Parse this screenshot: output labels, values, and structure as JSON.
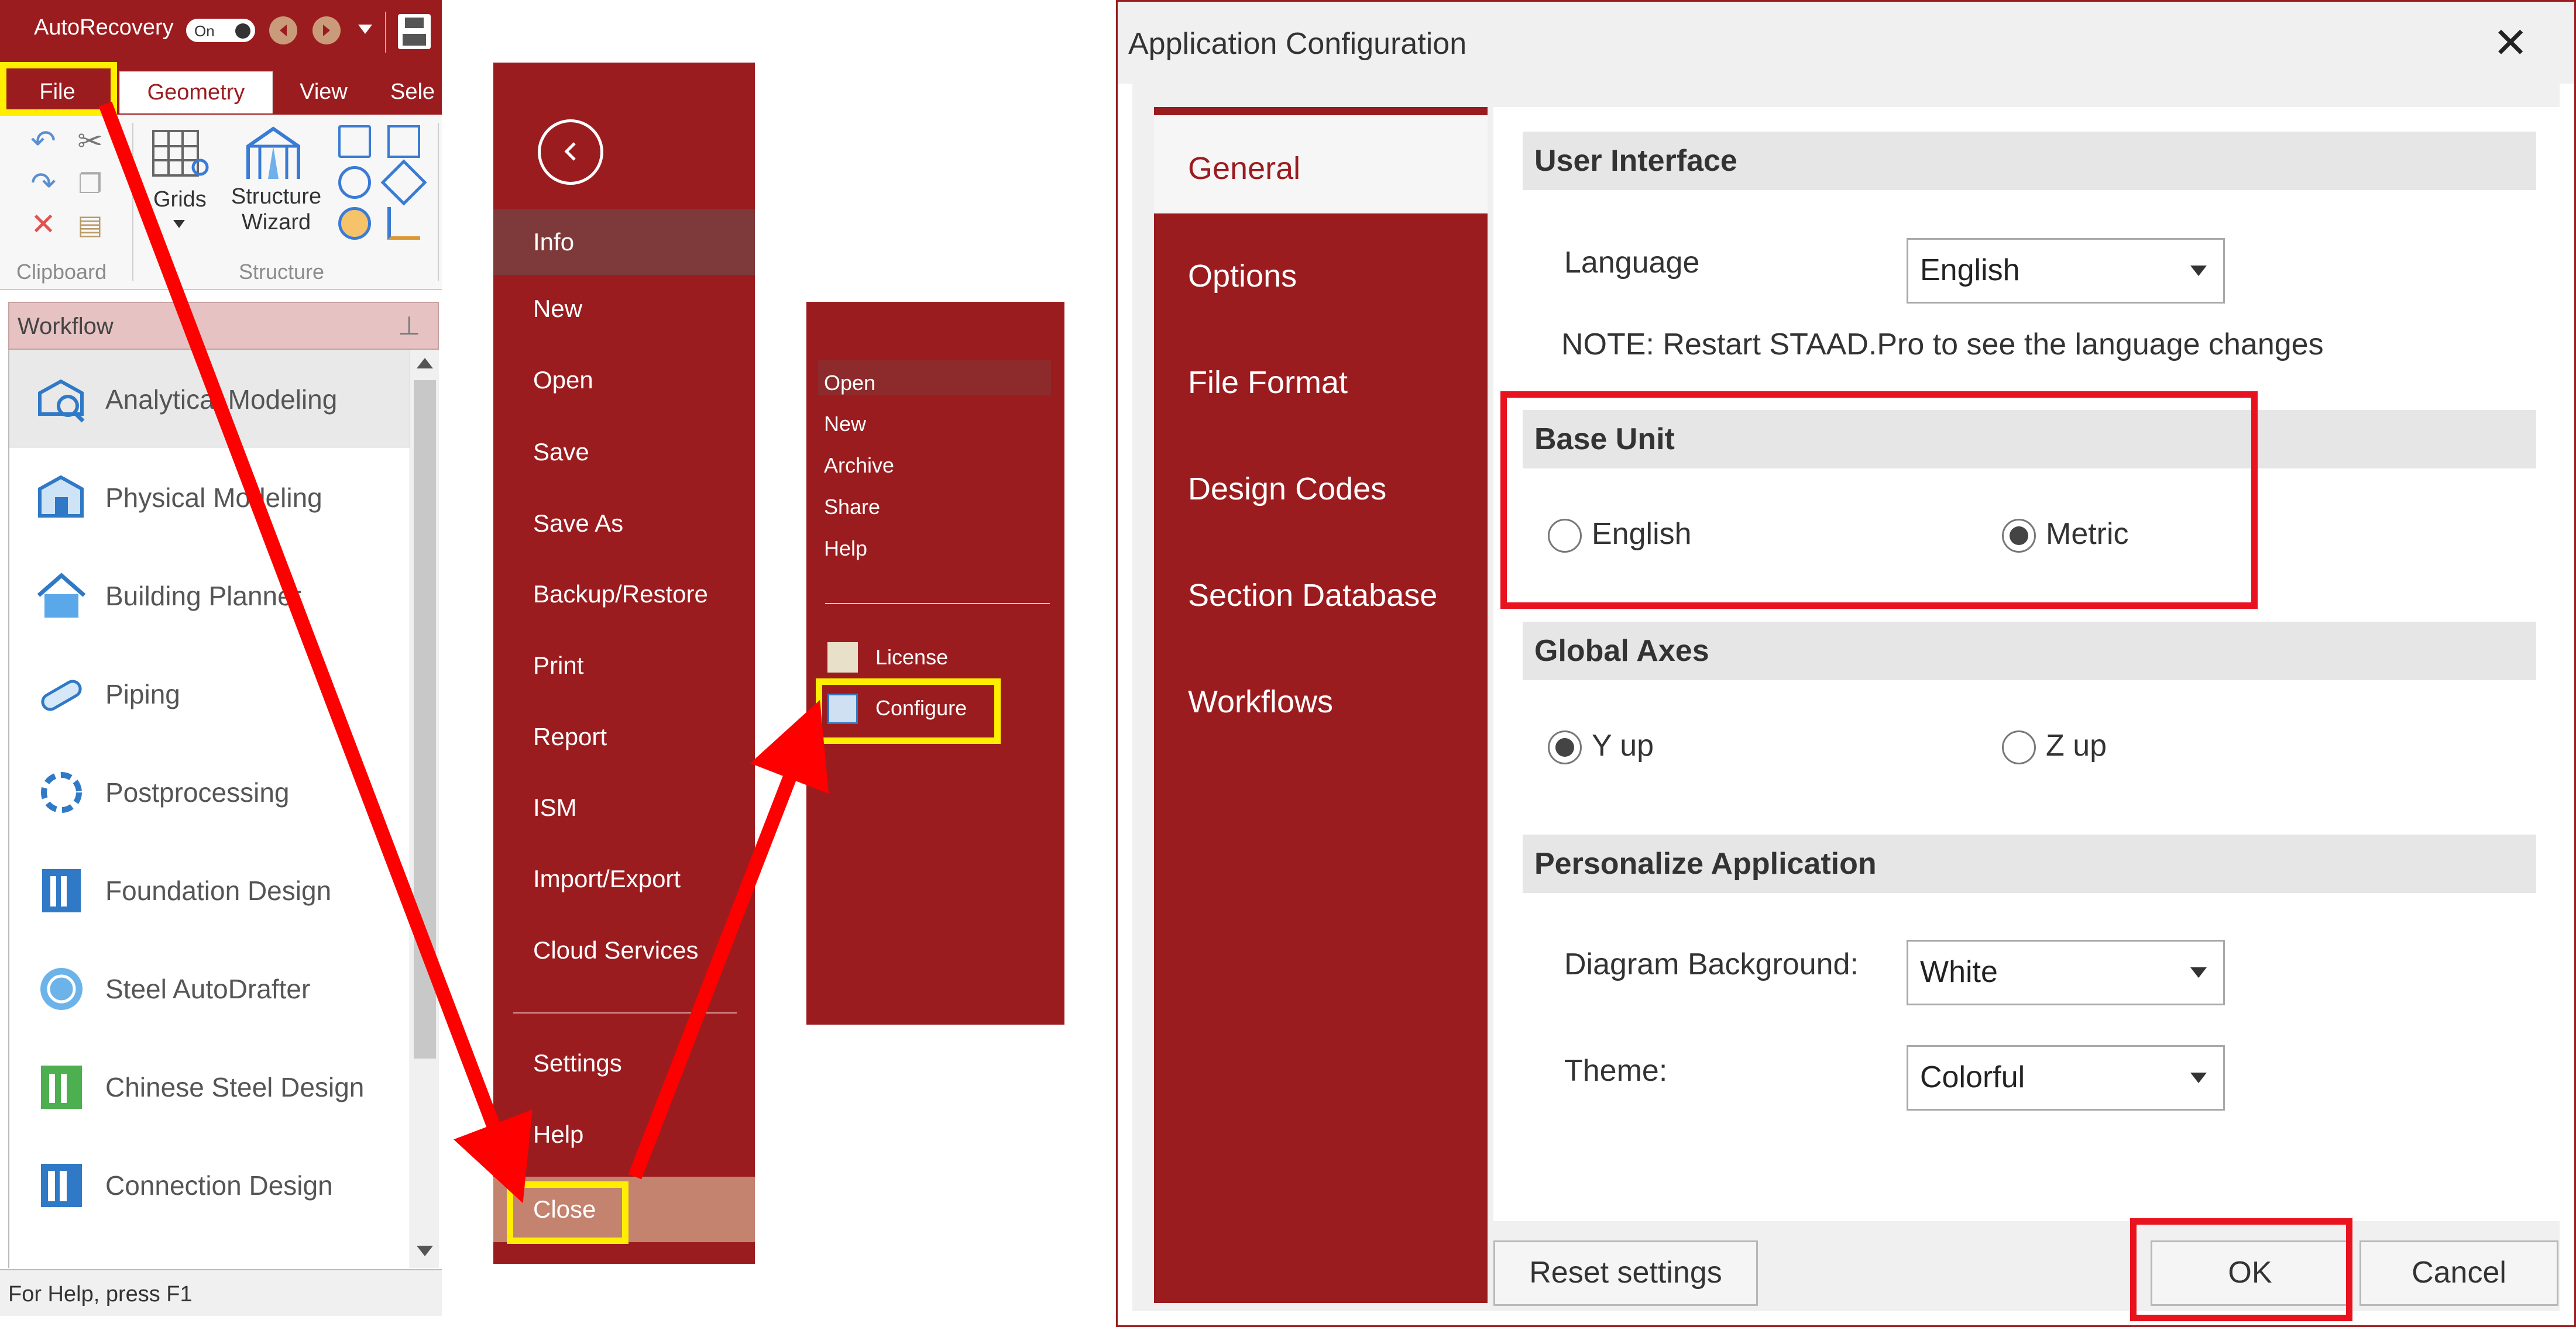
{
  "window": {
    "autorecovery_label": "AutoRecovery",
    "autorecovery_toggle": "On"
  },
  "ribbon": {
    "tabs": [
      "File",
      "Geometry",
      "View",
      "Sele"
    ],
    "active_tab": "Geometry",
    "grids_label": "Grids",
    "structure_wizard_label": "Structure\nWizard",
    "group_labels": [
      "Clipboard",
      "Structure"
    ]
  },
  "workflow": {
    "header": "Workflow",
    "items": [
      {
        "label": "Analytical Modeling",
        "icon": "analytical-modeling-icon"
      },
      {
        "label": "Physical Modeling",
        "icon": "physical-modeling-icon"
      },
      {
        "label": "Building Planner",
        "icon": "building-planner-icon"
      },
      {
        "label": "Piping",
        "icon": "piping-icon"
      },
      {
        "label": "Postprocessing",
        "icon": "postprocessing-icon"
      },
      {
        "label": "Foundation Design",
        "icon": "foundation-design-icon"
      },
      {
        "label": "Steel AutoDrafter",
        "icon": "steel-autodrafter-icon"
      },
      {
        "label": "Chinese Steel Design",
        "icon": "chinese-steel-design-icon"
      },
      {
        "label": "Connection Design",
        "icon": "connection-design-icon"
      }
    ],
    "status_text": "For Help, press F1"
  },
  "backstage": {
    "items": [
      "Info",
      "New",
      "Open",
      "Save",
      "Save As",
      "Backup/Restore",
      "Print",
      "Report",
      "ISM",
      "Import/Export",
      "Cloud Services"
    ],
    "bottom_items": [
      "Settings",
      "Help",
      "Close"
    ]
  },
  "submenu": {
    "items": [
      "Open",
      "New",
      "Archive",
      "Share",
      "Help"
    ],
    "bottom_items": [
      "License",
      "Configure"
    ]
  },
  "dialog": {
    "title": "Application Configuration",
    "nav": [
      "General",
      "Options",
      "File Format",
      "Design Codes",
      "Section Database",
      "Workflows"
    ],
    "user_interface": {
      "heading": "User Interface",
      "language_label": "Language",
      "language_value": "English",
      "note": "NOTE: Restart STAAD.Pro to see the language changes"
    },
    "base_unit": {
      "heading": "Base Unit",
      "options": [
        "English",
        "Metric"
      ],
      "selected": "Metric"
    },
    "global_axes": {
      "heading": "Global Axes",
      "options": [
        "Y up",
        "Z up"
      ],
      "selected": "Y up"
    },
    "personalize": {
      "heading": "Personalize Application",
      "background_label": "Diagram Background:",
      "background_value": "White",
      "theme_label": "Theme:",
      "theme_value": "Colorful"
    },
    "buttons": {
      "reset": "Reset settings",
      "ok": "OK",
      "cancel": "Cancel"
    }
  },
  "colors": {
    "brand_red": "#9b1c1f",
    "highlight_yellow": "#ffee00",
    "highlight_red": "#e8131f",
    "arrow_red": "#ff0000"
  }
}
